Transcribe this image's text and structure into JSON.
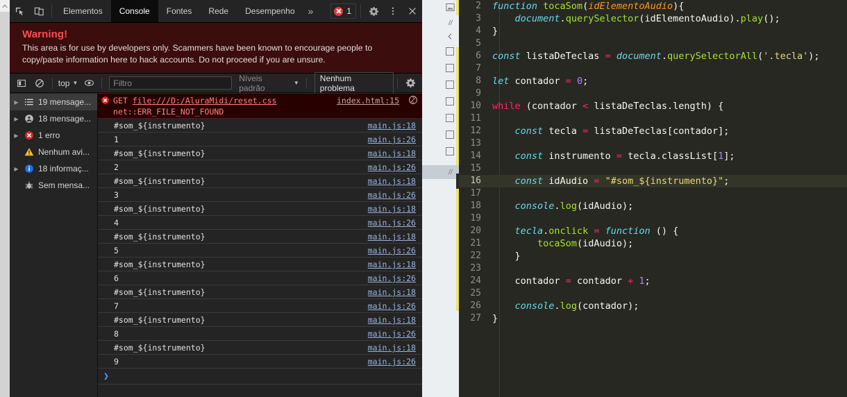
{
  "window": {
    "scrollbar_up_icon": "chevron-up-icon"
  },
  "devtools": {
    "toolbar": {
      "inspect_icon": "inspect-element-icon",
      "device_icon": "device-toolbar-icon",
      "tabs": [
        {
          "label": "Elementos",
          "active": false
        },
        {
          "label": "Console",
          "active": true
        },
        {
          "label": "Fontes",
          "active": false
        },
        {
          "label": "Rede",
          "active": false
        },
        {
          "label": "Desempenho",
          "active": false
        }
      ],
      "more_tabs_label": "»",
      "error_count": "1",
      "error_icon": "error-circle-icon",
      "settings_icon": "gear-icon",
      "kebab_icon": "more-vertical-icon",
      "close_icon": "close-icon"
    },
    "warning": {
      "title": "Warning!",
      "body": "This area is for use by developers only. Scammers have been known to encourage people to copy/paste information here to hack accounts. Do not proceed if you are unsure."
    },
    "filterbar": {
      "sidebar_toggle_icon": "show-console-sidebar-icon",
      "clear_icon": "clear-console-icon",
      "context": "top",
      "eye_icon": "live-expression-icon",
      "filter_placeholder": "Filtro",
      "levels_label": "Níveis padrão",
      "issues_label": "Nenhum problema",
      "settings_icon": "gear-icon"
    },
    "sidebar": {
      "items": [
        {
          "label": "19 mensage...",
          "icon": "list-icon",
          "arrow": true,
          "selected": true
        },
        {
          "label": "18 mensage...",
          "icon": "user-message-icon",
          "arrow": true,
          "selected": false
        },
        {
          "label": "1 erro",
          "icon": "error-circle-icon",
          "arrow": true,
          "selected": false
        },
        {
          "label": "Nenhum avi...",
          "icon": "warning-triangle-icon",
          "arrow": false,
          "selected": false
        },
        {
          "label": "18 informaç...",
          "icon": "info-circle-icon",
          "arrow": true,
          "selected": false
        },
        {
          "label": "Sem mensa...",
          "icon": "bug-icon",
          "arrow": false,
          "selected": false
        }
      ]
    },
    "console_messages": [
      {
        "type": "error",
        "method": "GET",
        "url": "file:///D:/AluraMidi/reset.css",
        "detail": "net::ERR_FILE_NOT_FOUND",
        "source": "index.html:15",
        "issue_icon": "issue-indicator-icon"
      },
      {
        "type": "log",
        "text": "#som_${instrumento}",
        "source": "main.js:18"
      },
      {
        "type": "num",
        "text": "1",
        "source": "main.js:26"
      },
      {
        "type": "log",
        "text": "#som_${instrumento}",
        "source": "main.js:18"
      },
      {
        "type": "num",
        "text": "2",
        "source": "main.js:26"
      },
      {
        "type": "log",
        "text": "#som_${instrumento}",
        "source": "main.js:18"
      },
      {
        "type": "num",
        "text": "3",
        "source": "main.js:26"
      },
      {
        "type": "log",
        "text": "#som_${instrumento}",
        "source": "main.js:18"
      },
      {
        "type": "num",
        "text": "4",
        "source": "main.js:26"
      },
      {
        "type": "log",
        "text": "#som_${instrumento}",
        "source": "main.js:18"
      },
      {
        "type": "num",
        "text": "5",
        "source": "main.js:26"
      },
      {
        "type": "log",
        "text": "#som_${instrumento}",
        "source": "main.js:18"
      },
      {
        "type": "num",
        "text": "6",
        "source": "main.js:26"
      },
      {
        "type": "log",
        "text": "#som_${instrumento}",
        "source": "main.js:18"
      },
      {
        "type": "num",
        "text": "7",
        "source": "main.js:26"
      },
      {
        "type": "log",
        "text": "#som_${instrumento}",
        "source": "main.js:18"
      },
      {
        "type": "num",
        "text": "8",
        "source": "main.js:26"
      },
      {
        "type": "log",
        "text": "#som_${instrumento}",
        "source": "main.js:18"
      },
      {
        "type": "num",
        "text": "9",
        "source": "main.js:26"
      }
    ],
    "prompt": {
      "chevron": "❯"
    }
  },
  "editor": {
    "current_line": 16,
    "first_visible_line": 2,
    "lines": [
      {
        "n": 2,
        "tokens": [
          {
            "t": "kw2",
            "v": "function"
          },
          {
            "t": "plain",
            "v": " "
          },
          {
            "t": "fn",
            "v": "tocaSom"
          },
          {
            "t": "plain",
            "v": "("
          },
          {
            "t": "par",
            "v": "idElementoAudio"
          },
          {
            "t": "plain",
            "v": "){"
          }
        ]
      },
      {
        "n": 3,
        "tokens": [
          {
            "t": "plain",
            "v": "    "
          },
          {
            "t": "obj",
            "v": "document"
          },
          {
            "t": "plain",
            "v": "."
          },
          {
            "t": "prop",
            "v": "querySelector"
          },
          {
            "t": "plain",
            "v": "(idElementoAudio)."
          },
          {
            "t": "prop",
            "v": "play"
          },
          {
            "t": "plain",
            "v": "();"
          }
        ]
      },
      {
        "n": 4,
        "tokens": [
          {
            "t": "plain",
            "v": "}"
          }
        ]
      },
      {
        "n": 5,
        "tokens": []
      },
      {
        "n": 6,
        "tokens": [
          {
            "t": "kw2",
            "v": "const"
          },
          {
            "t": "plain",
            "v": " listaDeTeclas "
          },
          {
            "t": "kw",
            "v": "="
          },
          {
            "t": "plain",
            "v": " "
          },
          {
            "t": "obj",
            "v": "document"
          },
          {
            "t": "plain",
            "v": "."
          },
          {
            "t": "prop",
            "v": "querySelectorAll"
          },
          {
            "t": "plain",
            "v": "("
          },
          {
            "t": "str",
            "v": "'.tecla'"
          },
          {
            "t": "plain",
            "v": ");"
          }
        ]
      },
      {
        "n": 7,
        "tokens": []
      },
      {
        "n": 8,
        "tokens": [
          {
            "t": "kw2",
            "v": "let"
          },
          {
            "t": "plain",
            "v": " contador "
          },
          {
            "t": "kw",
            "v": "="
          },
          {
            "t": "plain",
            "v": " "
          },
          {
            "t": "num",
            "v": "0"
          },
          {
            "t": "plain",
            "v": ";"
          }
        ]
      },
      {
        "n": 9,
        "tokens": []
      },
      {
        "n": 10,
        "tokens": [
          {
            "t": "kw",
            "v": "while"
          },
          {
            "t": "plain",
            "v": " (contador "
          },
          {
            "t": "kw",
            "v": "<"
          },
          {
            "t": "plain",
            "v": " listaDeTeclas.length) {"
          }
        ]
      },
      {
        "n": 11,
        "tokens": []
      },
      {
        "n": 12,
        "tokens": [
          {
            "t": "plain",
            "v": "    "
          },
          {
            "t": "kw2",
            "v": "const"
          },
          {
            "t": "plain",
            "v": " tecla "
          },
          {
            "t": "kw",
            "v": "="
          },
          {
            "t": "plain",
            "v": " listaDeTeclas[contador];"
          }
        ]
      },
      {
        "n": 13,
        "tokens": []
      },
      {
        "n": 14,
        "tokens": [
          {
            "t": "plain",
            "v": "    "
          },
          {
            "t": "kw2",
            "v": "const"
          },
          {
            "t": "plain",
            "v": " instrumento "
          },
          {
            "t": "kw",
            "v": "="
          },
          {
            "t": "plain",
            "v": " tecla.classList["
          },
          {
            "t": "num",
            "v": "1"
          },
          {
            "t": "plain",
            "v": "];"
          }
        ]
      },
      {
        "n": 15,
        "tokens": []
      },
      {
        "n": 16,
        "tokens": [
          {
            "t": "plain",
            "v": "    "
          },
          {
            "t": "kw2",
            "v": "const"
          },
          {
            "t": "plain",
            "v": " idAudio "
          },
          {
            "t": "kw",
            "v": "="
          },
          {
            "t": "plain",
            "v": " "
          },
          {
            "t": "str",
            "v": "\"#som_${instrumento}\""
          },
          {
            "t": "plain",
            "v": ";"
          }
        ]
      },
      {
        "n": 17,
        "tokens": []
      },
      {
        "n": 18,
        "tokens": [
          {
            "t": "plain",
            "v": "    "
          },
          {
            "t": "obj",
            "v": "console"
          },
          {
            "t": "plain",
            "v": "."
          },
          {
            "t": "prop",
            "v": "log"
          },
          {
            "t": "plain",
            "v": "(idAudio);"
          }
        ]
      },
      {
        "n": 19,
        "tokens": []
      },
      {
        "n": 20,
        "tokens": [
          {
            "t": "plain",
            "v": "    "
          },
          {
            "t": "obj",
            "v": "tecla"
          },
          {
            "t": "plain",
            "v": "."
          },
          {
            "t": "prop",
            "v": "onclick"
          },
          {
            "t": "plain",
            "v": " "
          },
          {
            "t": "kw",
            "v": "="
          },
          {
            "t": "plain",
            "v": " "
          },
          {
            "t": "kw2",
            "v": "function"
          },
          {
            "t": "plain",
            "v": " () {"
          }
        ]
      },
      {
        "n": 21,
        "tokens": [
          {
            "t": "plain",
            "v": "        "
          },
          {
            "t": "prop",
            "v": "tocaSom"
          },
          {
            "t": "plain",
            "v": "(idAudio);"
          }
        ]
      },
      {
        "n": 22,
        "tokens": [
          {
            "t": "plain",
            "v": "    }"
          }
        ]
      },
      {
        "n": 23,
        "tokens": []
      },
      {
        "n": 24,
        "tokens": [
          {
            "t": "plain",
            "v": "    contador "
          },
          {
            "t": "kw",
            "v": "="
          },
          {
            "t": "plain",
            "v": " contador "
          },
          {
            "t": "kw",
            "v": "+"
          },
          {
            "t": "plain",
            "v": " "
          },
          {
            "t": "num",
            "v": "1"
          },
          {
            "t": "plain",
            "v": ";"
          }
        ]
      },
      {
        "n": 25,
        "tokens": []
      },
      {
        "n": 26,
        "tokens": [
          {
            "t": "plain",
            "v": "    "
          },
          {
            "t": "obj",
            "v": "console"
          },
          {
            "t": "plain",
            "v": "."
          },
          {
            "t": "prop",
            "v": "log"
          },
          {
            "t": "plain",
            "v": "(contador);"
          }
        ]
      },
      {
        "n": 27,
        "tokens": [
          {
            "t": "plain",
            "v": "}"
          }
        ]
      }
    ]
  },
  "colors": {
    "devtools_bg": "#242424",
    "warning_bg": "#3b0d0d",
    "warning_title": "#ff4d4d",
    "error_row_bg": "#290000",
    "editor_bg": "#272822",
    "accent_yellow": "#e8e36e",
    "link": "#9ab3de"
  }
}
